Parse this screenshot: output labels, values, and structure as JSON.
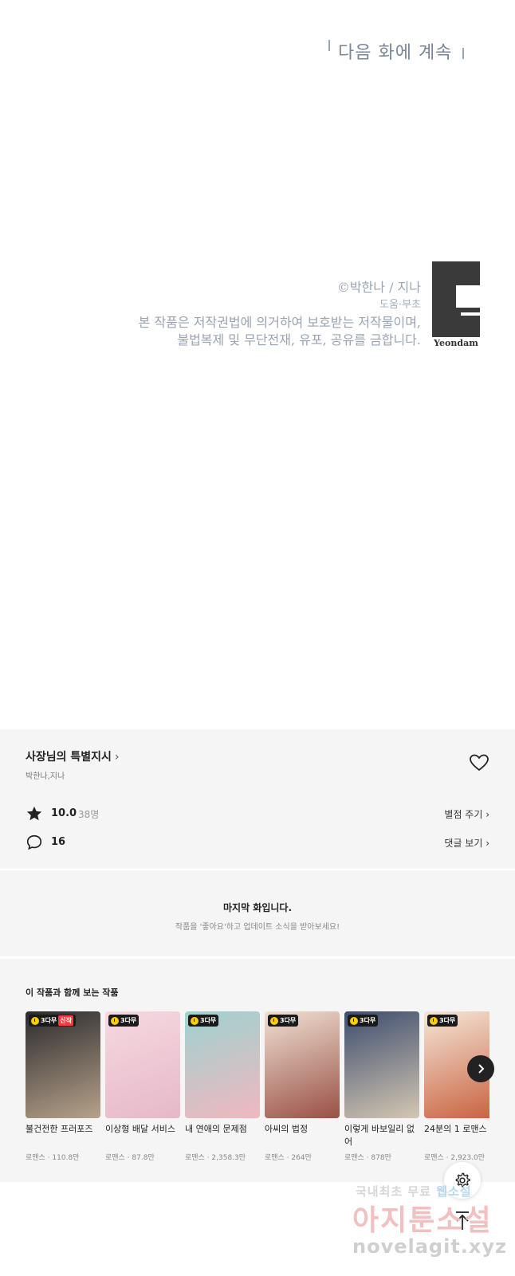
{
  "comic": {
    "next_episode": "다음 화에 계속",
    "copyright_line": "©박한나 / 지나",
    "assist_line": "도움·부초",
    "notice_line1": "본 작품은 저작권법에 의거하여 보호받는 저작물이며,",
    "notice_line2": "불법복제 및 무단전재, 유포, 공유를 금합니다.",
    "publisher_logo_text": "Yeondam"
  },
  "work": {
    "title": "사장님의 특별지시",
    "title_chevron": "›",
    "author": "박한나,지나",
    "rating": "10.0",
    "rating_count": "38명",
    "rate_link": "별점 주기 ›",
    "comment_count": "16",
    "comment_link": "댓글 보기 ›"
  },
  "last_episode": {
    "title": "마지막 화입니다.",
    "subtitle": "작품을 '좋아요'하고 업데이트 소식을 받아보세요!"
  },
  "recommendations": {
    "title": "이 작품과 함께 보는 작품",
    "items": [
      {
        "badge": "3다무",
        "new_badge": "신작",
        "title": "불건전한 프러포즈",
        "meta": "로맨스 · 110.8만",
        "colors": [
          "#2b2b2e",
          "#b7a28a"
        ]
      },
      {
        "badge": "3다무",
        "new_badge": "",
        "title": "이상형 배달 서비스",
        "meta": "로맨스 · 87.8만",
        "colors": [
          "#f6d9df",
          "#e6b8c9"
        ]
      },
      {
        "badge": "3다무",
        "new_badge": "",
        "title": "내 연애의 문제점",
        "meta": "로맨스 · 2,358.3만",
        "colors": [
          "#9ed2cf",
          "#f1b7c0"
        ]
      },
      {
        "badge": "3다무",
        "new_badge": "",
        "title": "아씨의 법정",
        "meta": "로맨스 · 264만",
        "colors": [
          "#efe1d3",
          "#9a5046"
        ]
      },
      {
        "badge": "3다무",
        "new_badge": "",
        "title": "이렇게 바보일리 없어",
        "meta": "로맨스 · 878만",
        "colors": [
          "#3d4d6e",
          "#d4c7b3"
        ]
      },
      {
        "badge": "3다무",
        "new_badge": "",
        "title": "24분의 1 로맨스",
        "meta": "로맨스 · 2,923.0만",
        "colors": [
          "#f5e7d8",
          "#c9603e"
        ]
      }
    ]
  },
  "watermark": {
    "line1_a": "국내최초 무료 ",
    "line1_b": "웹소설",
    "line2": "아지툰소설",
    "line3": "novelagit.xyz"
  },
  "colors": {
    "panel_bg": "#f5f5f5",
    "accent_yellow": "#ffcc00",
    "new_badge": "#ff3a3a"
  }
}
